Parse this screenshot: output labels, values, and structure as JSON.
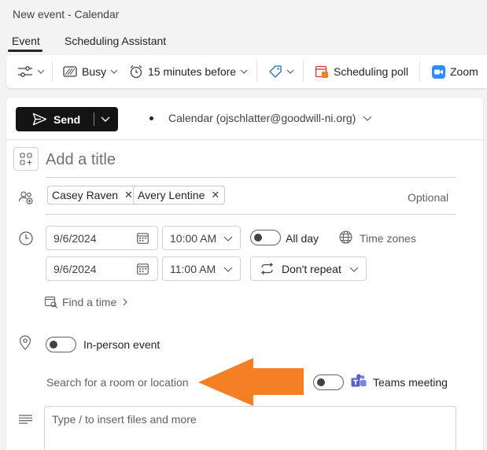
{
  "window": {
    "title": "New event - Calendar"
  },
  "tabs": [
    {
      "label": "Event",
      "active": true
    },
    {
      "label": "Scheduling Assistant",
      "active": false
    }
  ],
  "toolbar": {
    "show_as": "Busy",
    "reminder": "15 minutes before",
    "scheduling_poll": "Scheduling poll",
    "zoom": "Zoom"
  },
  "send": {
    "label": "Send"
  },
  "calendar": {
    "label": "Calendar (ojschlatter@goodwill-ni.org)"
  },
  "title_field": {
    "placeholder": "Add a title"
  },
  "attendees": {
    "chips": [
      {
        "name": "Casey Raven"
      },
      {
        "name": "Avery Lentine"
      }
    ],
    "optional_label": "Optional"
  },
  "schedule": {
    "start_date": "9/6/2024",
    "start_time": "10:00 AM",
    "end_date": "9/6/2024",
    "end_time": "11:00 AM",
    "all_day_label": "All day",
    "time_zones_label": "Time zones",
    "repeat": "Don't repeat",
    "find_a_time": "Find a time"
  },
  "location": {
    "in_person_label": "In-person event",
    "search_placeholder": "Search for a room or location",
    "teams_label": "Teams meeting"
  },
  "body": {
    "placeholder": "Type / to insert files and more"
  },
  "colors": {
    "accent_arrow": "#f47f24",
    "send_bg": "#141414",
    "teams": "#5b5fc7",
    "zoom": "#2d8cff",
    "poll": "#d13438"
  }
}
